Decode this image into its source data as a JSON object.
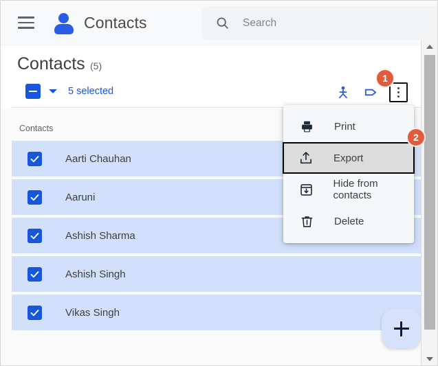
{
  "topbar": {
    "menu_icon": "hamburger-icon",
    "app_icon": "contacts-person-icon",
    "app_title": "Contacts",
    "search": {
      "icon": "search-icon",
      "placeholder": "Search",
      "value": ""
    }
  },
  "page": {
    "title": "Contacts",
    "count": "(5)",
    "selection": {
      "checkbox_state": "indeterminate",
      "dropdown_icon": "chevron-down-icon",
      "label": "5 selected"
    },
    "tools": [
      {
        "name": "merge-contacts-icon",
        "title": "Merge"
      },
      {
        "name": "label-tag-icon",
        "title": "Manage labels"
      },
      {
        "name": "more-options-icon",
        "title": "More actions"
      }
    ],
    "list_header": "Contacts"
  },
  "contacts": [
    {
      "name": "Aarti Chauhan",
      "checked": true
    },
    {
      "name": "Aaruni",
      "checked": true
    },
    {
      "name": "Ashish Sharma",
      "checked": true
    },
    {
      "name": "Ashish Singh",
      "checked": true
    },
    {
      "name": "Vikas Singh",
      "checked": true
    }
  ],
  "menu": {
    "items": [
      {
        "label": "Print",
        "icon": "printer-icon",
        "highlighted": false
      },
      {
        "label": "Export",
        "icon": "export-upload-icon",
        "highlighted": true
      },
      {
        "label": "Hide from contacts",
        "icon": "hide-archive-icon",
        "highlighted": false
      },
      {
        "label": "Delete",
        "icon": "trash-icon",
        "highlighted": false
      }
    ]
  },
  "badges": [
    {
      "id": "badge1",
      "label": "1"
    },
    {
      "id": "badge2",
      "label": "2"
    }
  ],
  "fab": {
    "icon": "plus-icon",
    "label": "Create contact"
  },
  "colors": {
    "accent_blue": "#1a56db",
    "row_selected": "#d2e0fb",
    "badge_orange": "#e05c3c",
    "menu_bg": "#f6f7f9"
  }
}
